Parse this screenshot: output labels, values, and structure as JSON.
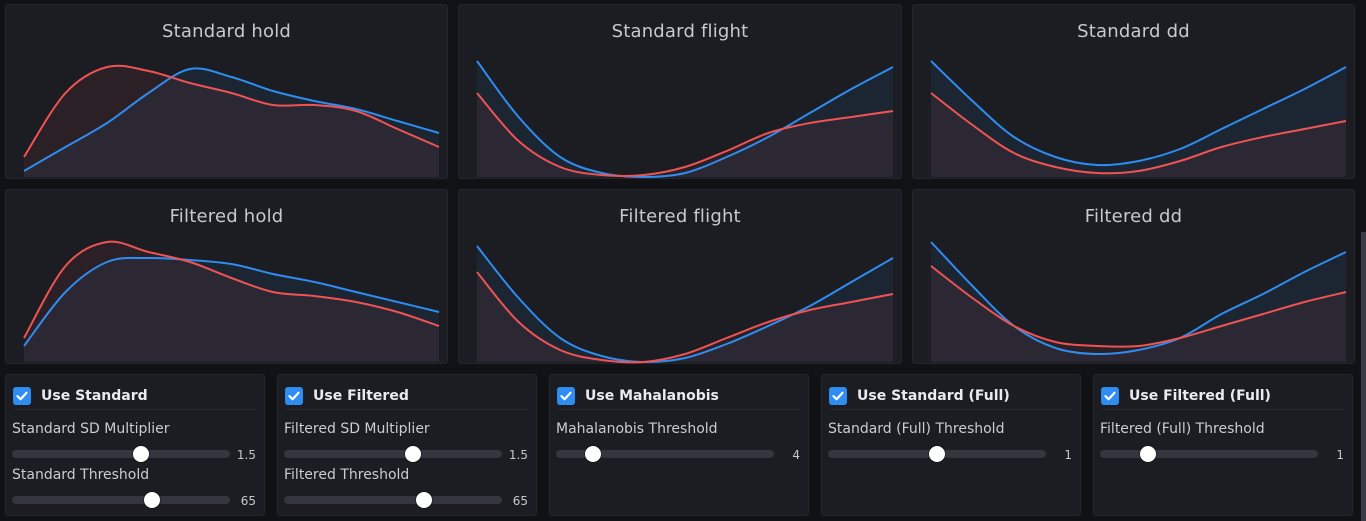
{
  "charts": [
    {
      "title": "Standard hold",
      "chart_data": {
        "type": "line",
        "title": "Standard hold",
        "x": [
          0,
          1,
          2,
          3,
          4,
          5,
          6,
          7,
          8,
          9,
          10
        ],
        "series": [
          {
            "color": "#2f8cf0",
            "values": [
              3,
              15,
              27,
              42,
              54,
              50,
              43,
              38,
              34,
              28,
              22
            ]
          },
          {
            "color": "#ef5353",
            "values": [
              10,
              42,
              55,
              53,
              47,
              42,
              36,
              36,
              33,
              24,
              15
            ]
          }
        ],
        "ylim": [
          0,
          65
        ],
        "grid": false
      }
    },
    {
      "title": "Standard flight",
      "chart_data": {
        "type": "line",
        "title": "Standard flight",
        "x": [
          0,
          1,
          2,
          3,
          4,
          5,
          6,
          7,
          8,
          9,
          10
        ],
        "series": [
          {
            "color": "#2f8cf0",
            "values": [
              58,
              30,
              10,
              2,
              0,
              2,
              10,
              20,
              32,
              44,
              55
            ]
          },
          {
            "color": "#ef5353",
            "values": [
              42,
              18,
              5,
              1,
              1,
              5,
              13,
              22,
              27,
              30,
              33
            ]
          }
        ],
        "ylim": [
          0,
          65
        ],
        "grid": false
      }
    },
    {
      "title": "Standard dd",
      "chart_data": {
        "type": "line",
        "title": "Standard dd",
        "x": [
          0,
          1,
          2,
          3,
          4,
          5,
          6,
          7,
          8,
          9,
          10
        ],
        "series": [
          {
            "color": "#2f8cf0",
            "values": [
              58,
              38,
              20,
              10,
              6,
              8,
              14,
              24,
              34,
              44,
              55
            ]
          },
          {
            "color": "#ef5353",
            "values": [
              42,
              26,
              12,
              5,
              2,
              3,
              8,
              15,
              20,
              24,
              28
            ]
          }
        ],
        "ylim": [
          0,
          65
        ],
        "grid": false
      }
    },
    {
      "title": "Filtered hold",
      "chart_data": {
        "type": "line",
        "title": "Filtered hold",
        "x": [
          0,
          1,
          2,
          3,
          4,
          5,
          6,
          7,
          8,
          9,
          10
        ],
        "series": [
          {
            "color": "#2f8cf0",
            "values": [
              8,
              35,
              50,
              52,
              51,
              49,
              44,
              40,
              35,
              30,
              25
            ]
          },
          {
            "color": "#ef5353",
            "values": [
              12,
              48,
              60,
              55,
              50,
              42,
              35,
              33,
              30,
              25,
              18
            ]
          }
        ],
        "ylim": [
          0,
          65
        ],
        "grid": false
      }
    },
    {
      "title": "Filtered flight",
      "chart_data": {
        "type": "line",
        "title": "Filtered flight",
        "x": [
          0,
          1,
          2,
          3,
          4,
          5,
          6,
          7,
          8,
          9,
          10
        ],
        "series": [
          {
            "color": "#2f8cf0",
            "values": [
              58,
              32,
              12,
              3,
              0,
              2,
              9,
              18,
              28,
              40,
              52
            ]
          },
          {
            "color": "#ef5353",
            "values": [
              45,
              20,
              6,
              1,
              0,
              4,
              12,
              20,
              26,
              30,
              34
            ]
          }
        ],
        "ylim": [
          0,
          65
        ],
        "grid": false
      }
    },
    {
      "title": "Filtered dd",
      "chart_data": {
        "type": "line",
        "title": "Filtered dd",
        "x": [
          0,
          1,
          2,
          3,
          4,
          5,
          6,
          7,
          8,
          9,
          10
        ],
        "series": [
          {
            "color": "#2f8cf0",
            "values": [
              60,
              38,
              18,
              7,
              4,
              6,
              12,
              24,
              34,
              45,
              55
            ]
          },
          {
            "color": "#ef5353",
            "values": [
              48,
              32,
              18,
              10,
              8,
              8,
              12,
              18,
              24,
              30,
              35
            ]
          }
        ],
        "ylim": [
          0,
          65
        ],
        "grid": false
      }
    }
  ],
  "controls": [
    {
      "label": "Use Standard",
      "checked": true,
      "sliders": [
        {
          "label": "Standard SD Multiplier",
          "value": "1.5",
          "fraction": 0.59
        },
        {
          "label": "Standard Threshold",
          "value": "65",
          "fraction": 0.64
        }
      ]
    },
    {
      "label": "Use Filtered",
      "checked": true,
      "sliders": [
        {
          "label": "Filtered SD Multiplier",
          "value": "1.5",
          "fraction": 0.59
        },
        {
          "label": "Filtered Threshold",
          "value": "65",
          "fraction": 0.64
        }
      ]
    },
    {
      "label": "Use Mahalanobis",
      "checked": true,
      "sliders": [
        {
          "label": "Mahalanobis Threshold",
          "value": "4",
          "fraction": 0.17
        }
      ]
    },
    {
      "label": "Use Standard (Full)",
      "checked": true,
      "sliders": [
        {
          "label": "Standard (Full) Threshold",
          "value": "1",
          "fraction": 0.5
        }
      ]
    },
    {
      "label": "Use Filtered (Full)",
      "checked": true,
      "sliders": [
        {
          "label": "Filtered (Full) Threshold",
          "value": "1",
          "fraction": 0.22
        }
      ]
    }
  ],
  "colors": {
    "accent": "#2f8cf0",
    "series_blue": "#2f8cf0",
    "series_red": "#ef5353",
    "panel_bg": "#1b1d22",
    "page_bg": "#101216"
  },
  "icons": {
    "checkbox": "check-icon"
  }
}
